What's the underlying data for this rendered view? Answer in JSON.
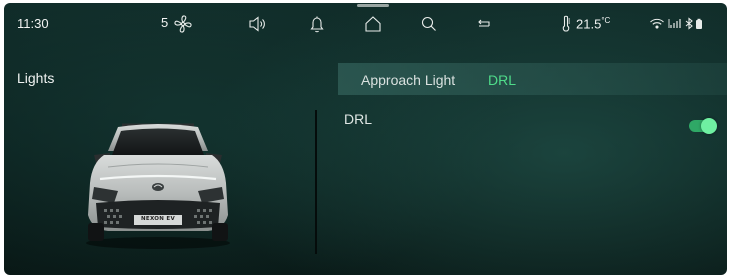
{
  "status_bar": {
    "time": "11:30",
    "fan_speed": "5",
    "temperature": "21.5",
    "temperature_unit": "°C",
    "icons": [
      "fan-icon",
      "speaker-icon",
      "bell-icon",
      "home-icon",
      "search-icon",
      "return-icon",
      "thermometer-icon",
      "wifi-icon",
      "signal-icon",
      "bluetooth-icon"
    ]
  },
  "page": {
    "title": "Lights"
  },
  "tabs": [
    {
      "label": "Approach Light",
      "active": false
    },
    {
      "label": "DRL",
      "active": true
    }
  ],
  "settings": [
    {
      "label": "DRL",
      "enabled": true
    }
  ],
  "car_badge": "NEXON EV",
  "colors": {
    "accent_green": "#4fdc8a",
    "toggle_on": "#2fa866",
    "background_dark": "#0c2321"
  }
}
